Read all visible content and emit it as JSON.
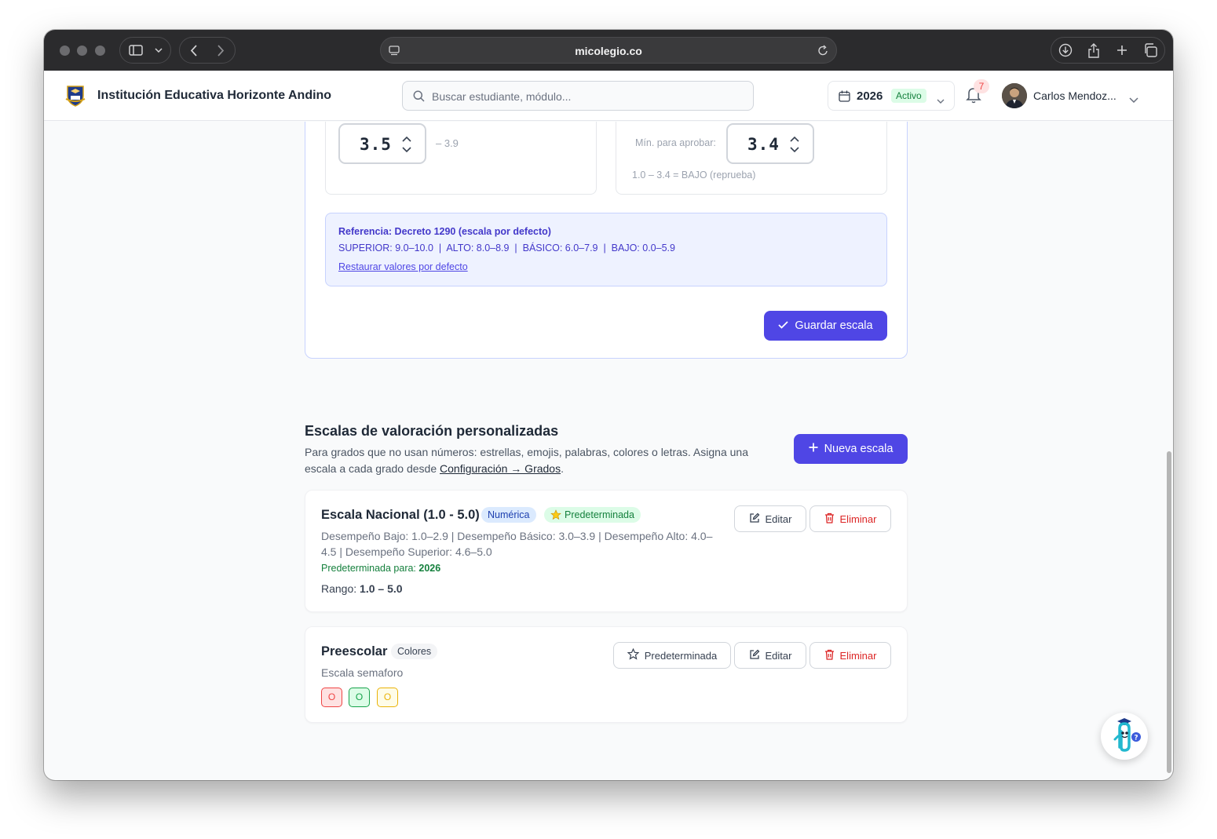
{
  "browser": {
    "url": "micolegio.co"
  },
  "header": {
    "school_name": "Institución Educativa Horizonte Andino",
    "search_placeholder": "Buscar estudiante, módulo...",
    "year": "2026",
    "year_status": "Activo",
    "notifications_count": "7",
    "user_name": "Carlos Mendoz..."
  },
  "config": {
    "band_left_value": "3.5",
    "band_left_upper": "– 3.9",
    "min_pass_label": "Mín. para aprobar:",
    "min_pass_value": "3.4",
    "fail_range_note": "1.0 – 3.4 = BAJO (reprueba)",
    "reference_title": "Referencia: Decreto 1290 (escala por defecto)",
    "reference_line": "SUPERIOR: 9.0–10.0  |  ALTO: 8.0–8.9  |  BÁSICO: 6.0–7.9  |  BAJO: 0.0–5.9",
    "restore_link": "Restaurar valores por defecto",
    "save_label": "Guardar escala"
  },
  "custom_scales": {
    "title": "Escalas de valoración personalizadas",
    "description_pre": "Para grados que no usan números: estrellas, emojis, palabras, colores o letras. Asigna una escala a cada grado desde ",
    "description_link": "Configuración → Grados",
    "description_post": ".",
    "new_label": "Nueva escala"
  },
  "scales": [
    {
      "name": "Escala Nacional (1.0 - 5.0)",
      "type_tag": "Numérica",
      "default_tag": "Predeterminada",
      "description": "Desempeño Bajo: 1.0–2.9 | Desempeño Básico: 3.0–3.9 | Desempeño Alto: 4.0–4.5 | Desempeño Superior: 4.6–5.0",
      "default_for_label": "Predeterminada para:",
      "default_for_value": "2026",
      "range_label": "Rango:",
      "range_value": "1.0 – 5.0",
      "edit_label": "Editar",
      "delete_label": "Eliminar"
    },
    {
      "name": "Preescolar",
      "type_tag": "Colores",
      "description": "Escala semaforo",
      "set_default_label": "Predeterminada",
      "edit_label": "Editar",
      "delete_label": "Eliminar",
      "chips": [
        {
          "text": "O",
          "color": "#ef4444",
          "bg": "#fee2e2"
        },
        {
          "text": "O",
          "color": "#16a34a",
          "bg": "#dcfce7"
        },
        {
          "text": "O",
          "color": "#eab308",
          "bg": "#fefce8"
        }
      ]
    }
  ],
  "colors": {
    "primary": "#4f46e5",
    "danger": "#dc2626",
    "success": "#15803d"
  }
}
